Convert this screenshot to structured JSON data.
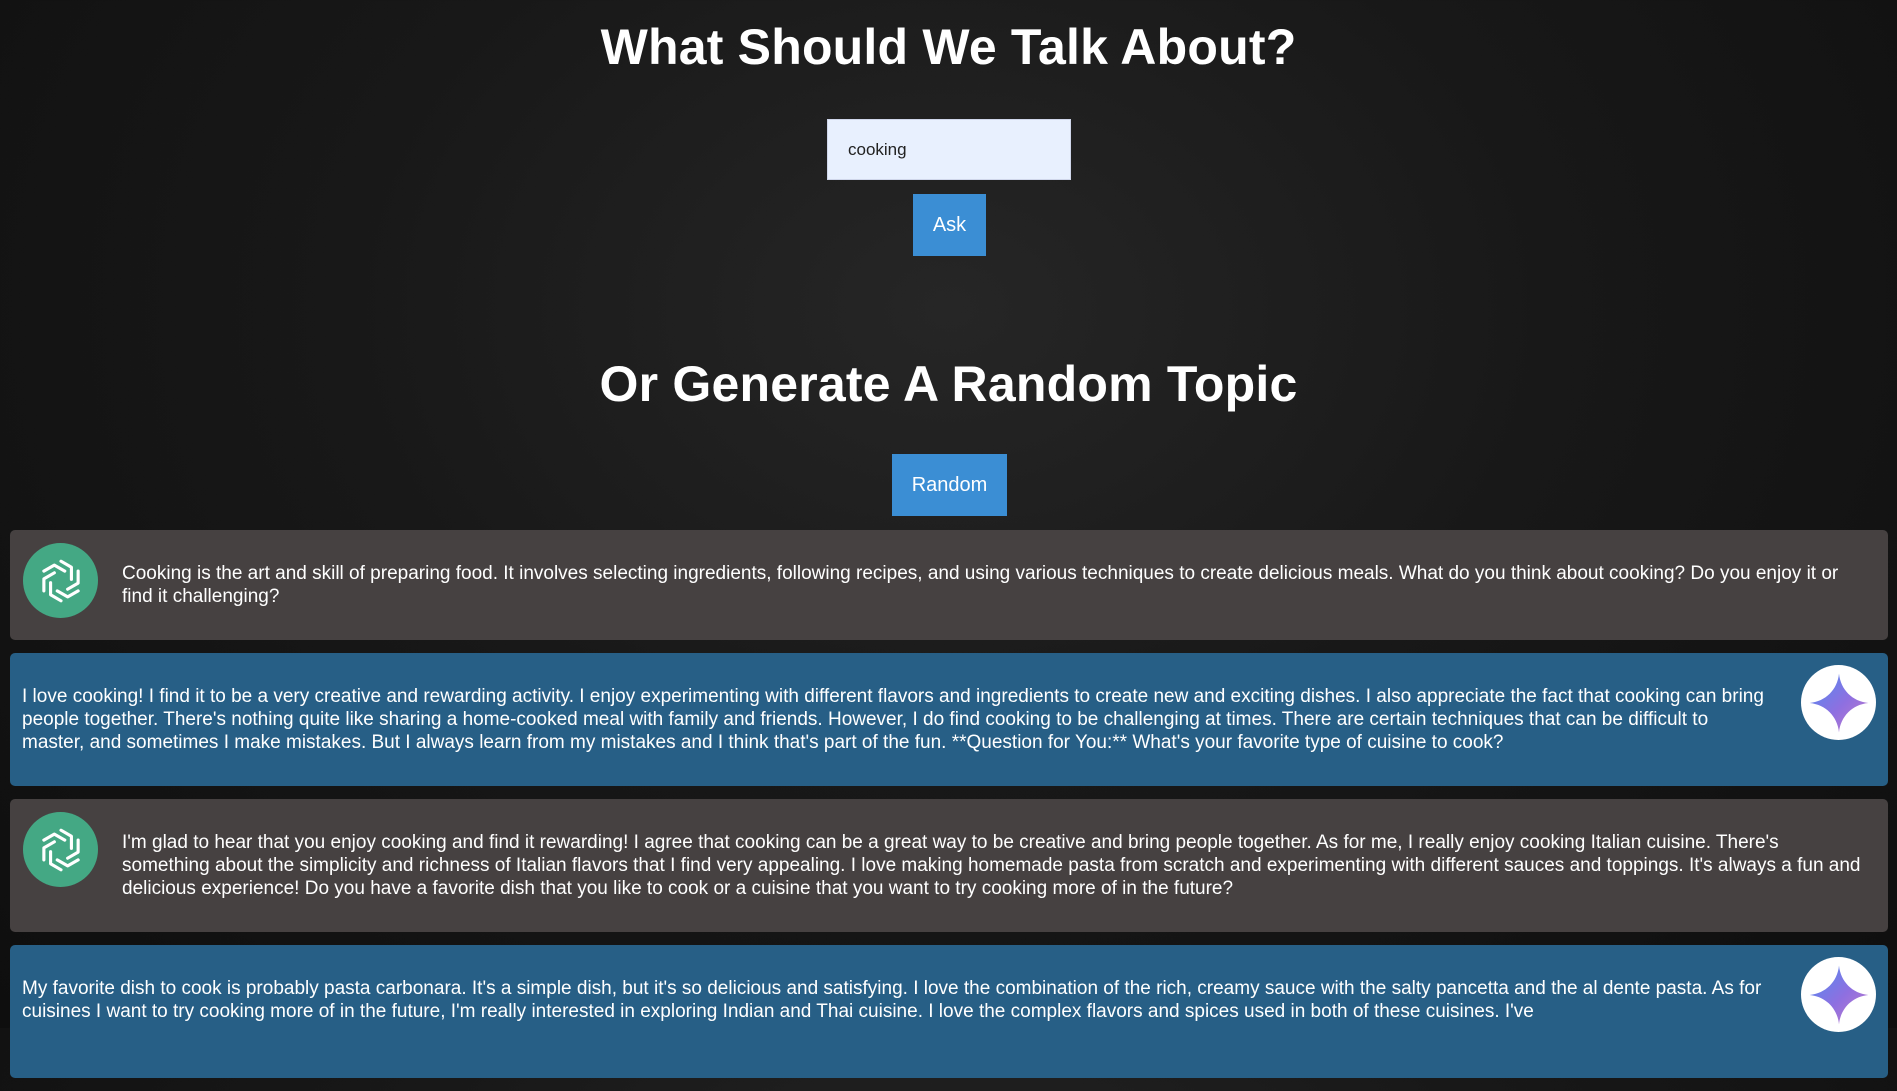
{
  "header": {
    "ask_title": "What Should We Talk About?",
    "random_title": "Or Generate A Random Topic"
  },
  "topic_input": {
    "value": "cooking"
  },
  "buttons": {
    "ask_label": "Ask",
    "random_label": "Random"
  },
  "colors": {
    "background": "#141414",
    "button": "#3b8ed4",
    "gpt_bubble": "#464141",
    "gemini_bubble": "#275f86",
    "gpt_avatar": "#44a884"
  },
  "icons": {
    "gpt_avatar": "openai-logo-icon",
    "gemini_avatar": "gemini-sparkle-icon"
  },
  "messages": [
    {
      "speaker": "gpt",
      "text": "Cooking is the art and skill of preparing food. It involves selecting ingredients, following recipes, and using various techniques to create delicious meals. What do you think about cooking? Do you enjoy it or find it challenging?"
    },
    {
      "speaker": "gemini",
      "text": "I love cooking! I find it to be a very creative and rewarding activity. I enjoy experimenting with different flavors and ingredients to create new and exciting dishes. I also appreciate the fact that cooking can bring people together. There's nothing quite like sharing a home-cooked meal with family and friends. However, I do find cooking to be challenging at times. There are certain techniques that can be difficult to master, and sometimes I make mistakes. But I always learn from my mistakes and I think that's part of the fun. **Question for You:** What's your favorite type of cuisine to cook?"
    },
    {
      "speaker": "gpt",
      "text": "I'm glad to hear that you enjoy cooking and find it rewarding! I agree that cooking can be a great way to be creative and bring people together. As for me, I really enjoy cooking Italian cuisine. There's something about the simplicity and richness of Italian flavors that I find very appealing. I love making homemade pasta from scratch and experimenting with different sauces and toppings. It's always a fun and delicious experience! Do you have a favorite dish that you like to cook or a cuisine that you want to try cooking more of in the future?"
    },
    {
      "speaker": "gemini",
      "text": "My favorite dish to cook is probably pasta carbonara. It's a simple dish, but it's so delicious and satisfying. I love the combination of the rich, creamy sauce with the salty pancetta and the al dente pasta. As for cuisines I want to try cooking more of in the future, I'm really interested in exploring Indian and Thai cuisine. I love the complex flavors and spices used in both of these cuisines. I've"
    }
  ]
}
